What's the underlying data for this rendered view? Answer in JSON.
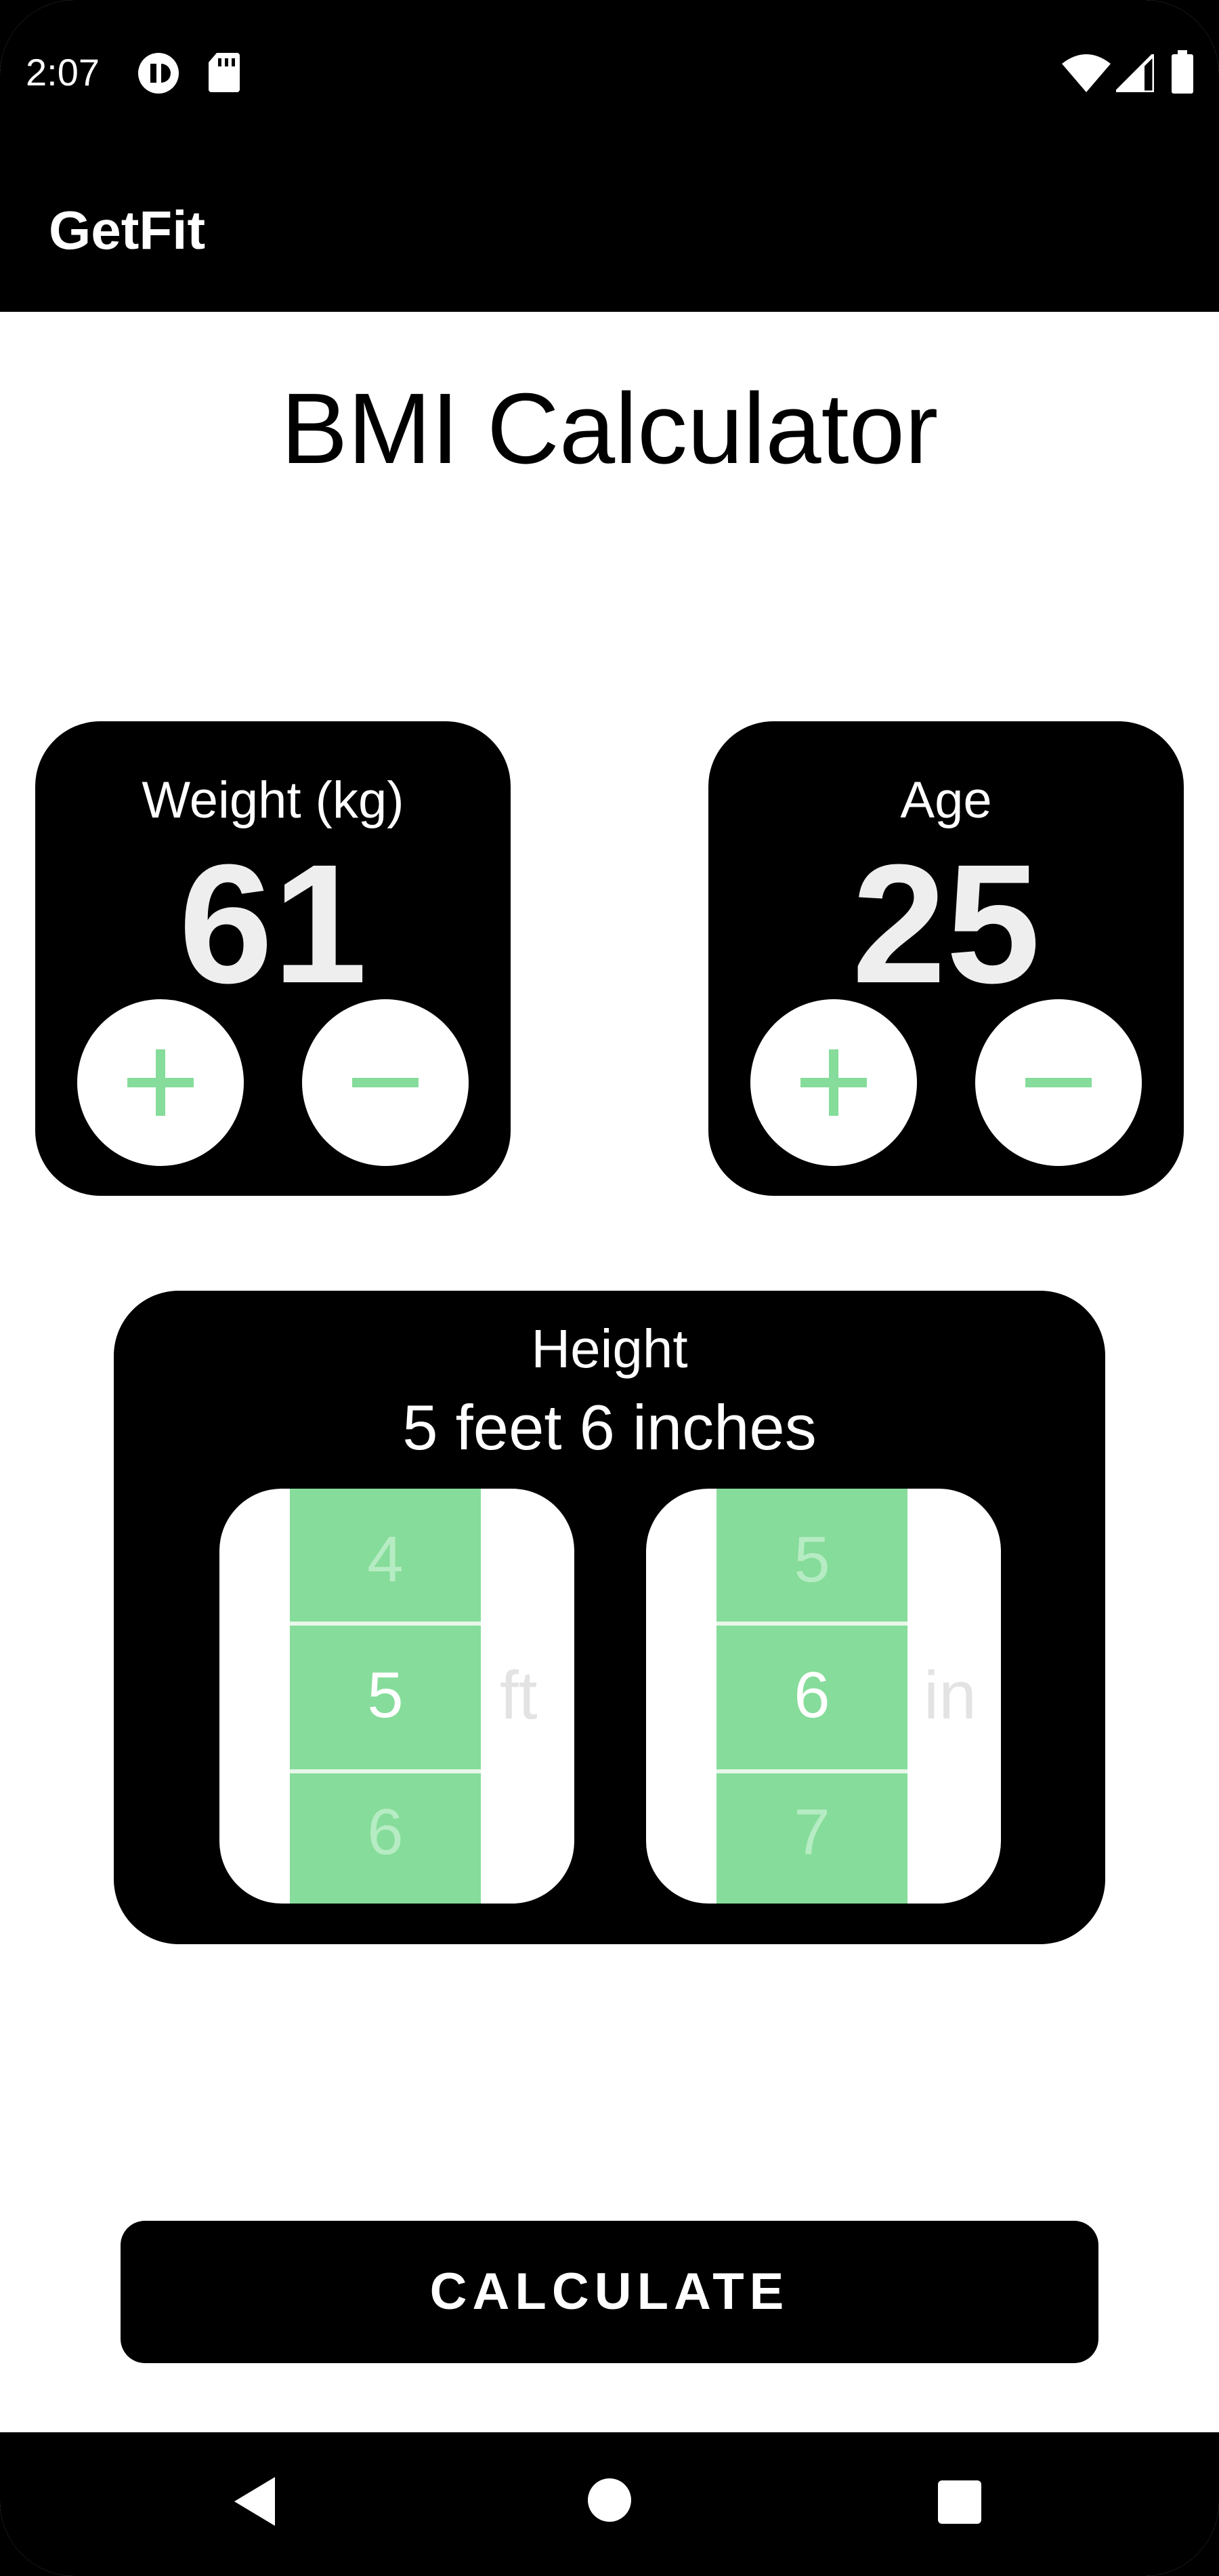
{
  "status_bar": {
    "time": "2:07",
    "left_icons": [
      "pause-circle-icon",
      "sd-card-icon"
    ],
    "right_icons": [
      "wifi-icon",
      "signal-icon",
      "battery-icon"
    ]
  },
  "app_bar": {
    "title": "GetFit"
  },
  "page": {
    "title": "BMI Calculator"
  },
  "weight_card": {
    "label": "Weight (kg)",
    "value": "61",
    "plus_icon": "plus-icon",
    "minus_icon": "minus-icon"
  },
  "age_card": {
    "label": "Age",
    "value": "25",
    "plus_icon": "plus-icon",
    "minus_icon": "minus-icon"
  },
  "height_card": {
    "label": "Height",
    "value": "5 feet 6 inches",
    "feet_picker": {
      "prev": "4",
      "selected": "5",
      "next": "6",
      "unit": "ft"
    },
    "inches_picker": {
      "prev": "5",
      "selected": "6",
      "next": "7",
      "unit": "in"
    }
  },
  "calculate_button": {
    "label": "CALCULATE"
  },
  "nav_bar": {
    "icons": [
      "back-icon",
      "home-icon",
      "recents-icon"
    ]
  },
  "colors": {
    "accent_green": "#86dc9a",
    "card_background": "#000000",
    "page_background": "#ffffff"
  }
}
